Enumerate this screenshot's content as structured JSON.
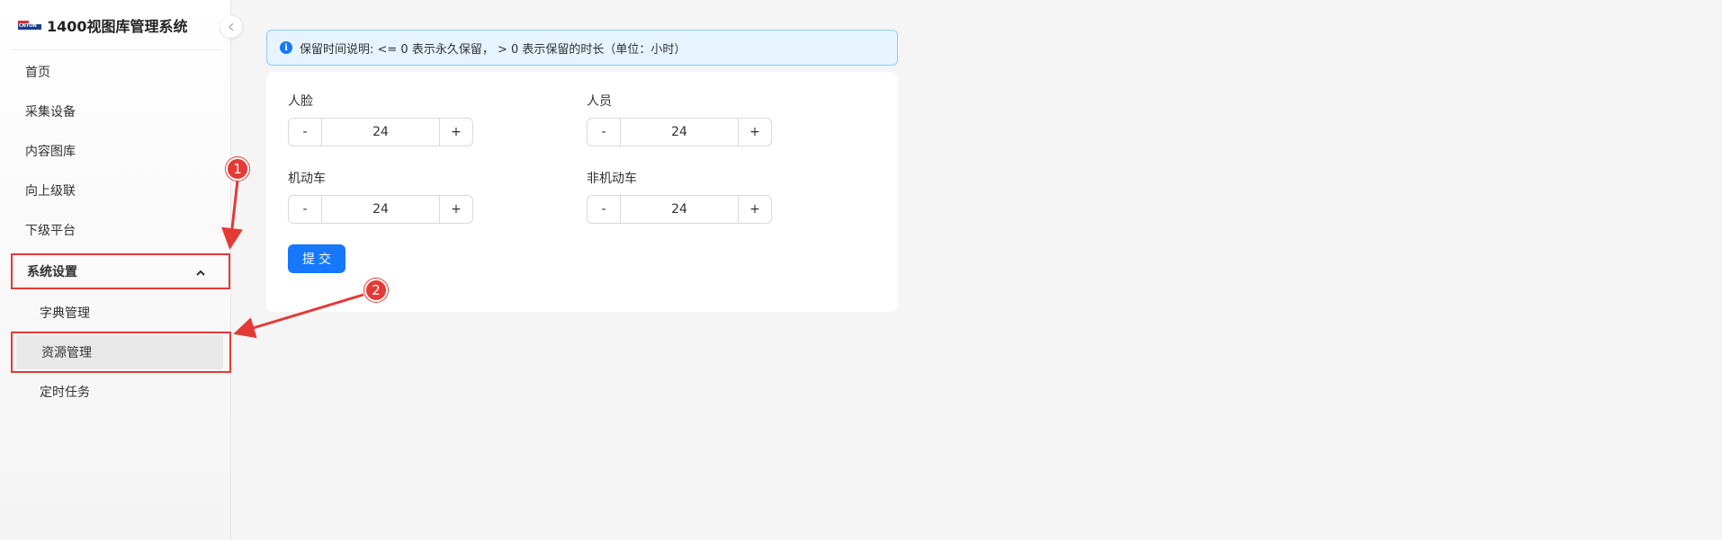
{
  "app": {
    "logo_text": "CNTON",
    "title": "1400视图库管理系统"
  },
  "sidebar": {
    "collapse_icon": "chevron-left-icon",
    "items": [
      {
        "label": "首页"
      },
      {
        "label": "采集设备"
      },
      {
        "label": "内容图库"
      },
      {
        "label": "向上级联"
      },
      {
        "label": "下级平台"
      }
    ],
    "open_group": {
      "label": "系统设置",
      "expanded": true,
      "children": [
        {
          "label": "字典管理"
        },
        {
          "label": "资源管理",
          "active": true
        },
        {
          "label": "定时任务"
        }
      ]
    }
  },
  "alert": {
    "icon": "info-icon",
    "text": "保留时间说明: <= 0 表示永久保留， > 0 表示保留的时长（单位：小时）"
  },
  "form": {
    "fields": [
      {
        "label": "人脸",
        "value": "24",
        "minus": "-",
        "plus": "+"
      },
      {
        "label": "人员",
        "value": "24",
        "minus": "-",
        "plus": "+"
      },
      {
        "label": "机动车",
        "value": "24",
        "minus": "-",
        "plus": "+"
      },
      {
        "label": "非机动车",
        "value": "24",
        "minus": "-",
        "plus": "+"
      }
    ],
    "submit_label": "提交"
  },
  "annotations": {
    "badge_1": "1",
    "badge_2": "2",
    "highlight_color": "#e53935"
  }
}
